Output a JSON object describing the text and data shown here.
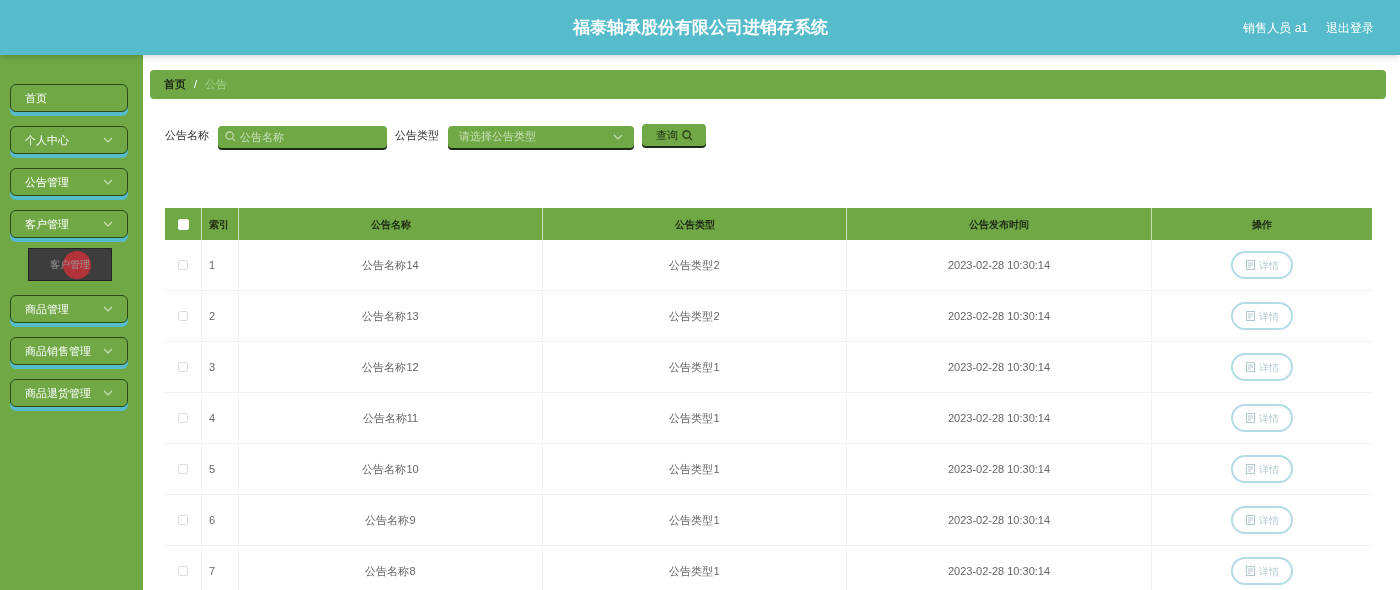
{
  "header": {
    "title": "福泰轴承股份有限公司进销存系统",
    "user": "销售人员 a1",
    "logout": "退出登录"
  },
  "sidebar": {
    "items": [
      {
        "label": "首页",
        "kind": "link"
      },
      {
        "label": "个人中心",
        "kind": "menu"
      },
      {
        "label": "公告管理",
        "kind": "menu"
      },
      {
        "label": "客户管理",
        "kind": "menu",
        "children": [
          {
            "label": "客户管理",
            "hovered": true
          }
        ]
      },
      {
        "label": "商品管理",
        "kind": "menu"
      },
      {
        "label": "商品销售管理",
        "kind": "menu"
      },
      {
        "label": "商品退货管理",
        "kind": "menu"
      }
    ]
  },
  "breadcrumb": {
    "separator": "/",
    "items": [
      {
        "label": "首页",
        "current": false
      },
      {
        "label": "公告",
        "current": true
      }
    ]
  },
  "search": {
    "name_label": "公告名称",
    "name_placeholder": "公告名称",
    "type_label": "公告类型",
    "type_placeholder": "请选择公告类型",
    "button": "查询"
  },
  "table": {
    "select_all_checked": false,
    "columns": [
      "索引",
      "公告名称",
      "公告类型",
      "公告发布时间",
      "操作"
    ],
    "rows": [
      {
        "checked": false,
        "cells": [
          "1",
          "公告名称14",
          "公告类型2",
          "2023-02-28 10:30:14"
        ],
        "action": "详情"
      },
      {
        "checked": false,
        "cells": [
          "2",
          "公告名称13",
          "公告类型2",
          "2023-02-28 10:30:14"
        ],
        "action": "详情"
      },
      {
        "checked": false,
        "cells": [
          "3",
          "公告名称12",
          "公告类型1",
          "2023-02-28 10:30:14"
        ],
        "action": "详情"
      },
      {
        "checked": false,
        "cells": [
          "4",
          "公告名称11",
          "公告类型1",
          "2023-02-28 10:30:14"
        ],
        "action": "详情"
      },
      {
        "checked": false,
        "cells": [
          "5",
          "公告名称10",
          "公告类型1",
          "2023-02-28 10:30:14"
        ],
        "action": "详情"
      },
      {
        "checked": false,
        "cells": [
          "6",
          "公告名称9",
          "公告类型1",
          "2023-02-28 10:30:14"
        ],
        "action": "详情"
      },
      {
        "checked": false,
        "cells": [
          "7",
          "公告名称8",
          "公告类型1",
          "2023-02-28 10:30:14"
        ],
        "action": "详情"
      }
    ]
  }
}
